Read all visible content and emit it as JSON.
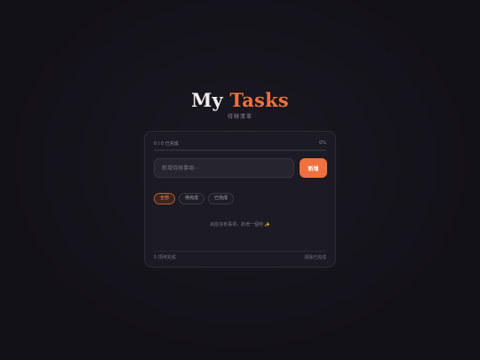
{
  "header": {
    "title_word1": "My",
    "title_word2": "Tasks",
    "subtitle": "待辦清單"
  },
  "progress": {
    "count_text": "0 / 0 已完成",
    "percent_text": "0%",
    "fraction": 0
  },
  "input": {
    "placeholder": "新增待辦事項⋯",
    "value": ""
  },
  "add_button": {
    "label": "新增"
  },
  "filters": [
    {
      "label": "全部",
      "active": true
    },
    {
      "label": "待完成",
      "active": false
    },
    {
      "label": "已完成",
      "active": false
    }
  ],
  "empty_state": {
    "text": "目前沒有事項，新增一個吧 ✨"
  },
  "footer": {
    "remaining_text": "0 項待完成",
    "clear_label": "清除已完成"
  },
  "colors": {
    "accent": "#f07040",
    "background": "#14121a",
    "card": "#1c1a22"
  }
}
